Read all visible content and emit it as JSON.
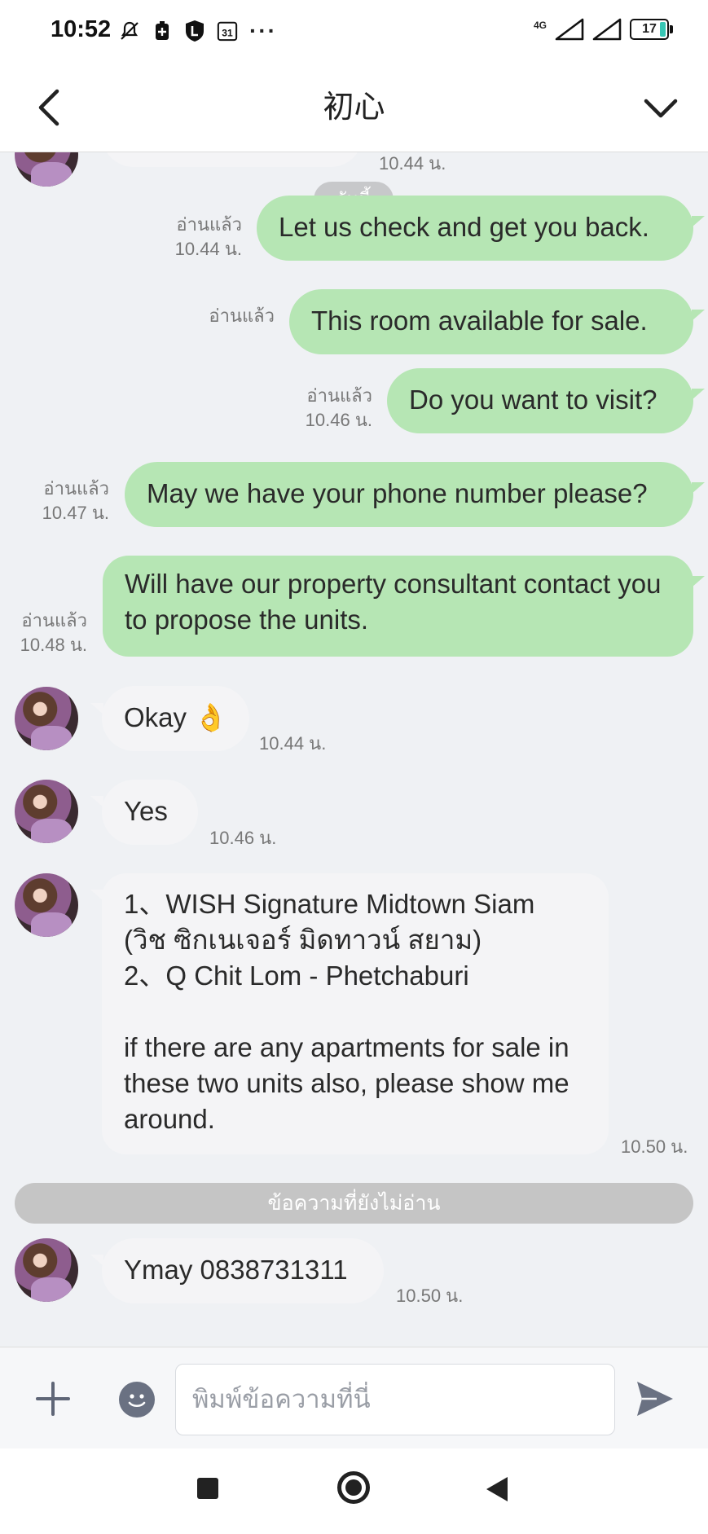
{
  "status_bar": {
    "time": "10:52",
    "calendar_day": "31",
    "dots": "···",
    "network": "4G",
    "battery": "17"
  },
  "header": {
    "title": "初心"
  },
  "chat": {
    "date_chip": "วันนี้",
    "top_partial_time": "10.44 น.",
    "outgoing": [
      {
        "text": "Let us check and get you back.",
        "read": "อ่านแล้ว",
        "time": "10.44 น."
      },
      {
        "text": "This room available for sale.",
        "read": "อ่านแล้ว",
        "time": ""
      },
      {
        "text": "Do you want to visit?",
        "read": "อ่านแล้ว",
        "time": "10.46 น."
      },
      {
        "text": "May we have your phone number please?",
        "read": "อ่านแล้ว",
        "time": "10.47 น."
      },
      {
        "text": "Will have our property consultant contact you to propose the units.",
        "read": "อ่านแล้ว",
        "time": "10.48 น."
      }
    ],
    "incoming": [
      {
        "text": "Okay 👌",
        "time": "10.44 น."
      },
      {
        "text": "Yes",
        "time": "10.46 น."
      },
      {
        "text": "1、WISH Signature Midtown Siam\n(วิช ซิกเนเจอร์ มิดทาวน์ สยาม)\n2、Q Chit Lom - Phetchaburi\n\nif there are any apartments for sale in these two units also, please show me around.",
        "time": "10.50 น."
      },
      {
        "text": "Ymay 0838731311",
        "time": "10.50 น."
      }
    ],
    "unread_divider": "ข้อความที่ยังไม่อ่าน"
  },
  "composer": {
    "placeholder": "พิมพ์ข้อความที่นี่",
    "value": ""
  },
  "colors": {
    "outgoing_bubble": "#b6e6b4",
    "incoming_bubble": "#f4f4f6",
    "background": "#eff1f4",
    "accent": "#6a7182"
  }
}
